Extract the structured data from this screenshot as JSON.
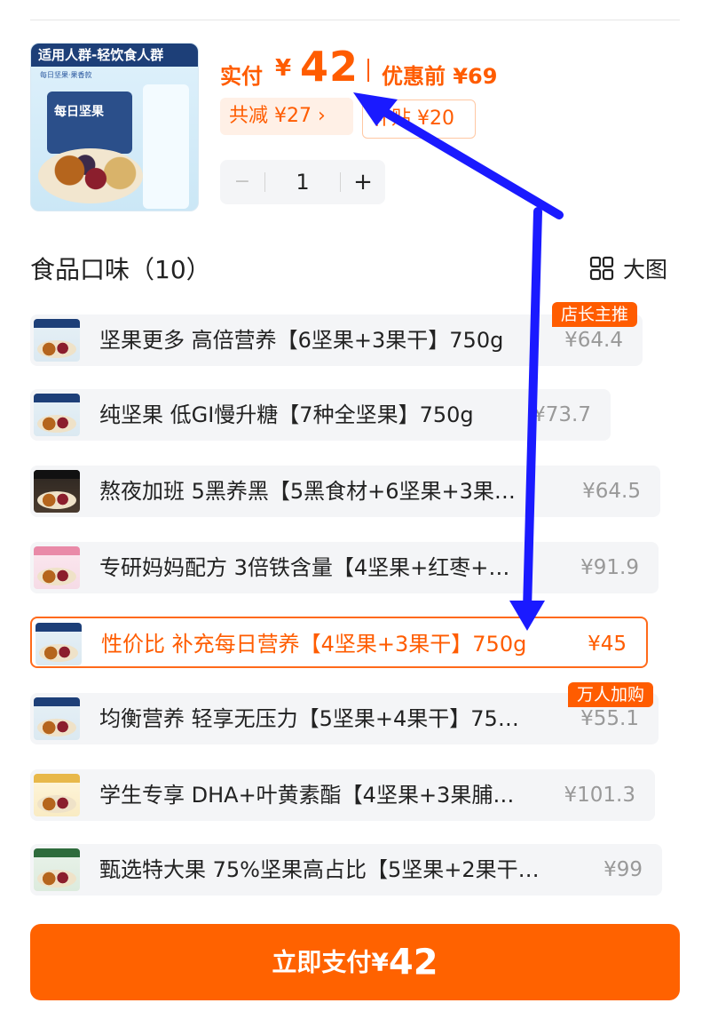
{
  "header": {
    "thumb_banner": "适用人群-轻饮食人群",
    "thumb_sub": "每日坚果·果香款",
    "thumb_box": "每日坚果"
  },
  "price": {
    "paid_label": "实付",
    "currency": "¥",
    "paid_amount": "42",
    "original_label": "优惠前 ¥69",
    "saved_label": "共减 ¥27 ›",
    "subsidy_label": "补贴 ¥20"
  },
  "quantity": {
    "minus": "−",
    "value": "1",
    "plus": "+"
  },
  "section": {
    "title": "食品口味（10）",
    "view_toggle": "大图"
  },
  "options": [
    {
      "text": "坚果更多 高倍营养【6坚果+3果干】750g",
      "price": "¥64.4",
      "badge": "店长主推",
      "selected": false
    },
    {
      "text": "纯坚果 低GI慢升糖【7种全坚果】750g",
      "price": "¥73.7",
      "badge": "",
      "selected": false
    },
    {
      "text": "熬夜加班 5黑养黑【5黑食材+6坚果+3果…",
      "price": "¥64.5",
      "badge": "",
      "selected": false
    },
    {
      "text": "专研妈妈配方 3倍铁含量【4坚果+红枣+…",
      "price": "¥91.9",
      "badge": "",
      "selected": false
    },
    {
      "text": "性价比 补充每日营养【4坚果+3果干】750g",
      "price": "¥45",
      "badge": "",
      "selected": true
    },
    {
      "text": "均衡营养 轻享无压力【5坚果+4果干】75…",
      "price": "¥55.1",
      "badge": "万人加购",
      "selected": false
    },
    {
      "text": "学生专享 DHA+叶黄素酯【4坚果+3果脯…",
      "price": "¥101.3",
      "badge": "",
      "selected": false
    },
    {
      "text": "甄选特大果 75%坚果高占比【5坚果+2果干…",
      "price": "¥99",
      "badge": "",
      "selected": false
    }
  ],
  "pay_button": {
    "label": "立即支付",
    "currency": "¥",
    "amount": "42"
  },
  "colors": {
    "accent": "#ff5c00",
    "annotation_arrow": "#1a1aff"
  }
}
